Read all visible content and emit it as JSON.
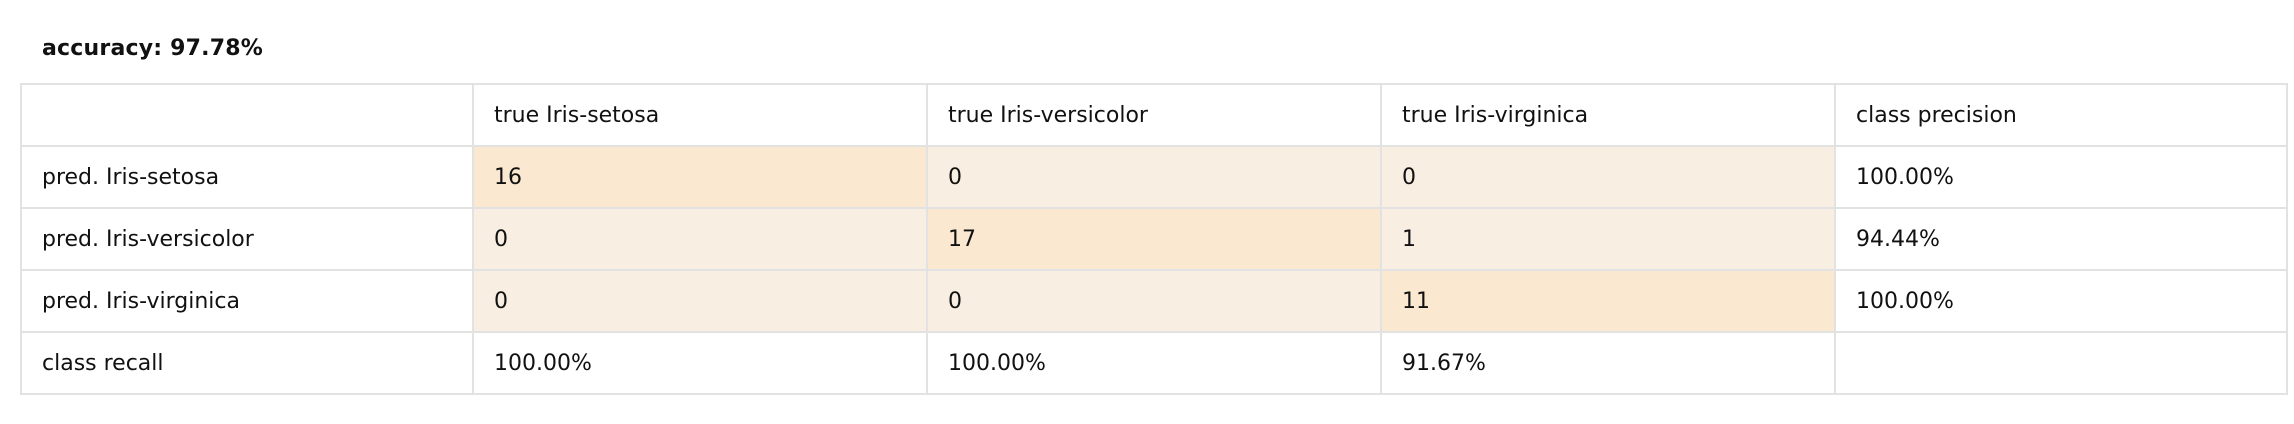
{
  "accuracy_label": "accuracy: 97.78%",
  "confusion_matrix": {
    "header": {
      "corner": "",
      "columns": [
        "true Iris-setosa",
        "true Iris-versicolor",
        "true Iris-virginica",
        "class precision"
      ]
    },
    "rows": [
      {
        "label": "pred. Iris-setosa",
        "counts": [
          "16",
          "0",
          "0"
        ],
        "precision": "100.00%"
      },
      {
        "label": "pred. Iris-versicolor",
        "counts": [
          "0",
          "17",
          "1"
        ],
        "precision": "94.44%"
      },
      {
        "label": "pred. Iris-virginica",
        "counts": [
          "0",
          "0",
          "11"
        ],
        "precision": "100.00%"
      }
    ],
    "recall_row": {
      "label": "class recall",
      "values": [
        "100.00%",
        "100.00%",
        "91.67%"
      ],
      "precision": ""
    }
  },
  "colors": {
    "diagonal_cell": "#fae8d0",
    "off_diagonal_cell": "#f8eee2",
    "grid_line": "#e2e2e2"
  }
}
